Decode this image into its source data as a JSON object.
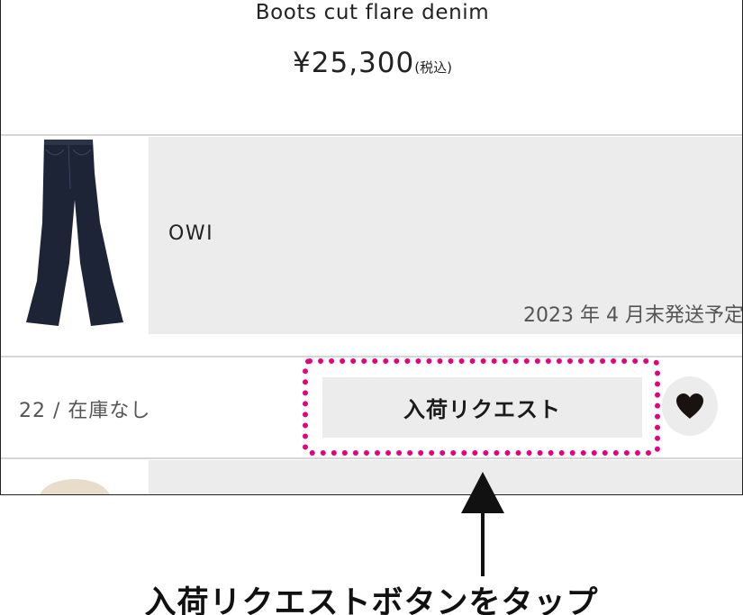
{
  "product": {
    "name": "Boots cut flare denim",
    "price": "¥25,300",
    "tax_note": "(税込)"
  },
  "item": {
    "brand": "OWI",
    "shipping_note": "2023 年 4 月末発送予定",
    "variant_status": "22 / 在庫なし",
    "request_button_label": "入荷リクエスト"
  },
  "annotation": {
    "caption": "入荷リクエストボタンをタップ",
    "highlight_color": "#e6007e"
  },
  "icons": {
    "favorite": "heart-icon",
    "arrow": "up-arrow-icon"
  }
}
